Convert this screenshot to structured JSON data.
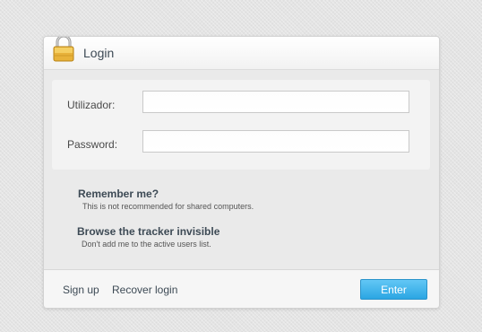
{
  "header": {
    "title": "Login",
    "icon": "lock-icon"
  },
  "form": {
    "username_label": "Utilizador:",
    "username_value": "",
    "password_label": "Password:",
    "password_value": ""
  },
  "options": {
    "remember_title": "Remember me?",
    "remember_desc": "This is not recommended for shared computers.",
    "invisible_title": "Browse the tracker invisible",
    "invisible_desc": "Don't add me to the active users list."
  },
  "footer": {
    "signup_label": "Sign up",
    "recover_label": "Recover login",
    "enter_label": "Enter"
  },
  "colors": {
    "accent": "#2ba6e3",
    "text": "#3d4a55"
  }
}
